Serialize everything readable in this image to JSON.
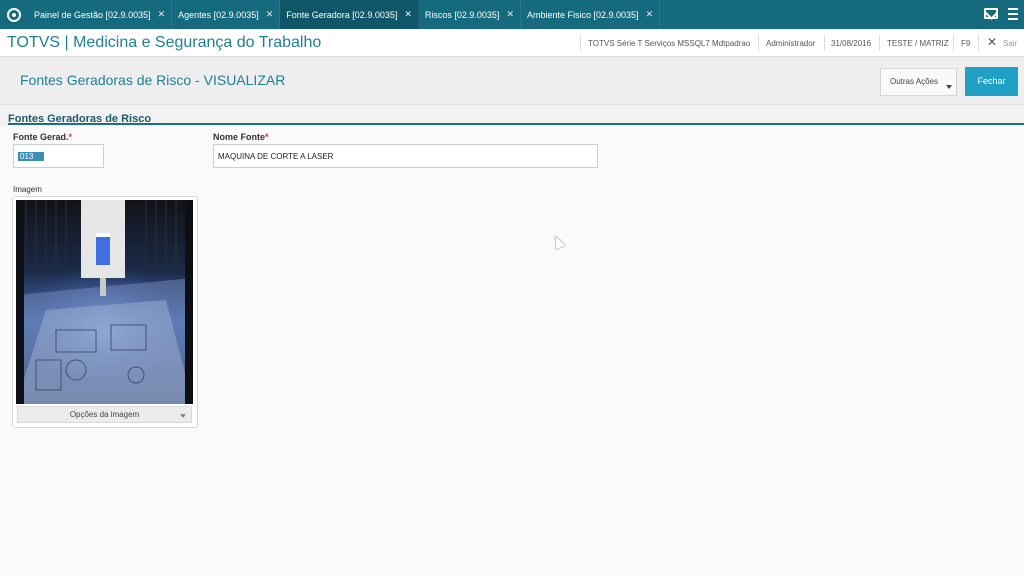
{
  "tabs": [
    {
      "label": "Painel de Gestão [02.9.0035]",
      "active": false
    },
    {
      "label": "Agentes [02.9.0035]",
      "active": false
    },
    {
      "label": "Fonte Geradora [02.9.0035]",
      "active": true
    },
    {
      "label": "Riscos [02.9.0035]",
      "active": false
    },
    {
      "label": "Ambiente Fisico [02.9.0035]",
      "active": false
    }
  ],
  "header": {
    "app_title": "TOTVS | Medicina e Segurança do Trabalho",
    "environment": "TOTVS Série T Serviços MSSQL7 Mdtpadrao",
    "user": "Administrador",
    "date": "31/08/2016",
    "branch": "TESTE / MATRIZ",
    "shortcut": "F9",
    "logout_label": "Sair"
  },
  "page": {
    "title": "Fontes Geradoras de Risco - VISUALIZAR",
    "other_actions_label": "Outras Ações",
    "close_label": "Fechar",
    "section_title": "Fontes Geradoras de Risco"
  },
  "form": {
    "source_code_label": "Fonte Gerad.",
    "source_code_value": "013",
    "source_name_label": "Nome Fonte",
    "source_name_value": "MAQUINA DE CORTE A LASER",
    "required_mark": "*",
    "image_label": "Imagem",
    "image_options_label": "Opções da imagem"
  }
}
